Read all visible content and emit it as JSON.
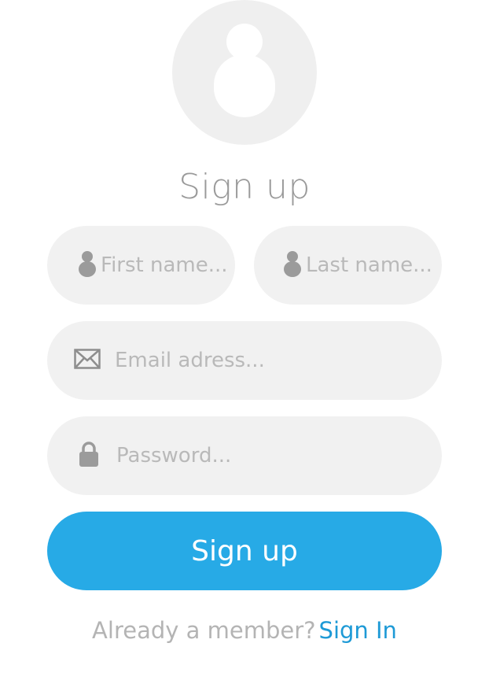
{
  "header": {
    "title": "Sign up"
  },
  "form": {
    "first_name": {
      "placeholder": "First name...",
      "icon": "user-icon"
    },
    "last_name": {
      "placeholder": "Last name...",
      "icon": "user-icon"
    },
    "email": {
      "placeholder": "Email adress...",
      "icon": "envelope-icon"
    },
    "password": {
      "placeholder": "Password...",
      "icon": "lock-icon"
    },
    "submit_label": "Sign up"
  },
  "footer": {
    "prompt": "Already a member?",
    "link_label": "Sign In"
  },
  "colors": {
    "accent": "#27aae6",
    "link": "#1e9ad6",
    "field_bg": "#f1f1f1",
    "avatar_bg": "#efefef"
  }
}
